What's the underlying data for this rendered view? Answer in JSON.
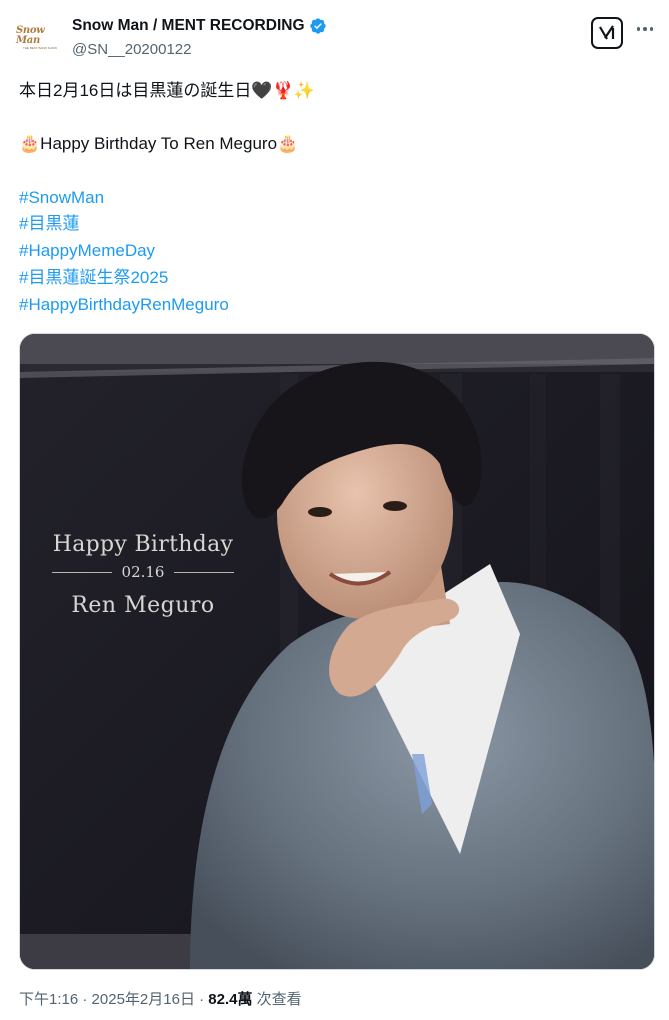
{
  "header": {
    "avatar_logo_main": "Snow Man",
    "avatar_logo_sub": "THE BEST BAND SHOW",
    "display_name": "Snow Man / MENT RECORDING",
    "handle": "@SN__20200122",
    "grok_label": "∖/|"
  },
  "tweet": {
    "line1": "本日2月16日は目黒蓮の誕生日🖤🦞✨",
    "line2": "🎂Happy Birthday To Ren Meguro🎂",
    "hashtags": [
      "#SnowMan",
      "#目黒蓮",
      "#HappyMemeDay",
      "#目黒蓮誕生祭2025",
      "#HappyBirthdayRenMeguro"
    ]
  },
  "media": {
    "title": "Happy Birthday",
    "date": "02.16",
    "name": "Ren Meguro"
  },
  "meta": {
    "time": "下午1:16",
    "separator": " · ",
    "date": "2025年2月16日",
    "views_count": "82.4萬",
    "views_label": " 次查看"
  },
  "colors": {
    "link": "#1d9bf0",
    "verified": "#1d9bf0",
    "secondary_text": "#536471",
    "primary_text": "#0f1419"
  },
  "icons": [
    "verified-badge-icon",
    "grok-icon",
    "more-icon"
  ]
}
